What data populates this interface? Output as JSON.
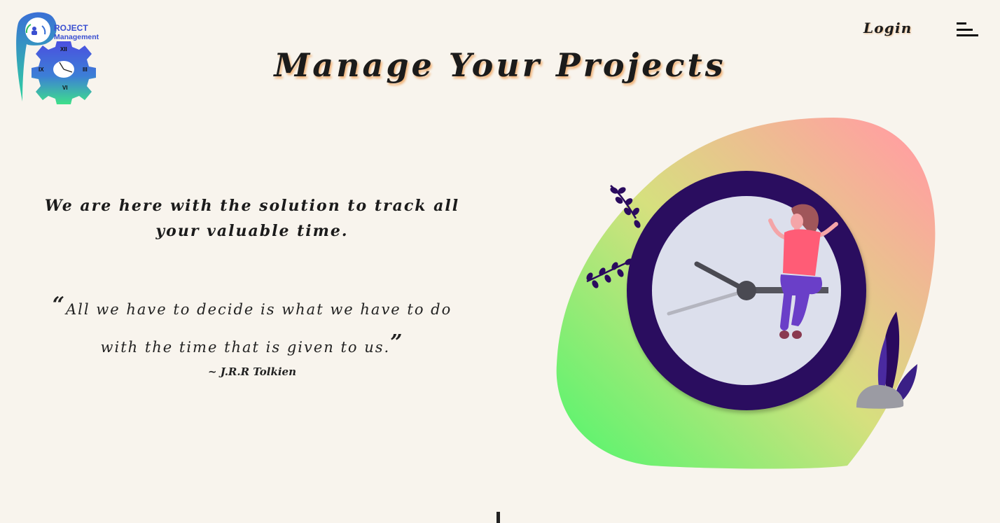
{
  "header": {
    "logo": {
      "line1": "ROJECT",
      "line2": "Management",
      "clock_numerals": [
        "XII",
        "III",
        "VI",
        "IX"
      ]
    },
    "login_label": "Login",
    "menu_icon": "hamburger-menu-icon"
  },
  "hero": {
    "title": "Manage Your Projects",
    "tagline": "We are here with the solution to track all your valuable time.",
    "quote": {
      "open_mark": "“",
      "text": "All we have to decide is what we have to do with the time that is given to us.",
      "close_mark": "”",
      "author": "~ J.R.R Tolkien"
    }
  },
  "colors": {
    "background": "#f8f4ed",
    "title_shadow": "#f0b277",
    "blob_gradient": [
      "#5cf46f",
      "#d6e07e",
      "#ffa1a0"
    ],
    "clock_ring": "#2a0a5e",
    "clock_face": "#dcdfec",
    "logo_blue": "#3a4fd1"
  }
}
